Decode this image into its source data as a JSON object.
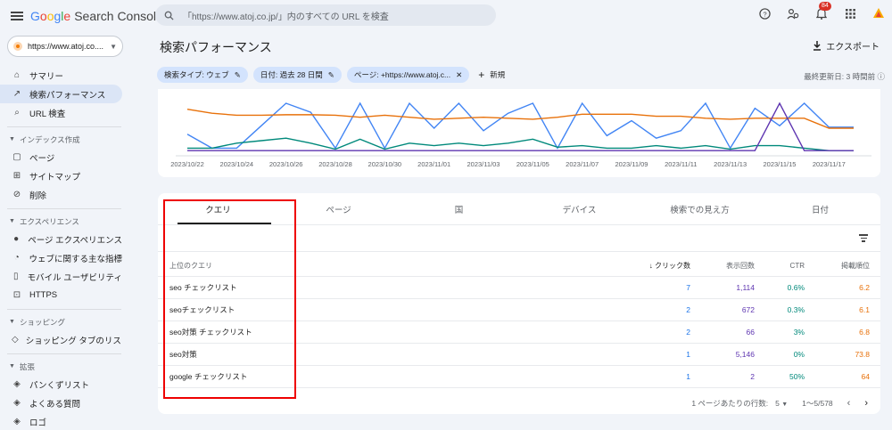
{
  "app": {
    "title_letters": [
      "G",
      "o",
      "o",
      "g",
      "l",
      "e"
    ],
    "title_suffix": "Search Console"
  },
  "search": {
    "placeholder": "「https://www.atoj.co.jp/」内のすべての URL を検査"
  },
  "topbar": {
    "notification_count": "84"
  },
  "sidebar": {
    "property": "https://www.atoj.co....",
    "items": [
      {
        "label": "サマリー",
        "icon": "home-icon"
      },
      {
        "label": "検索パフォーマンス",
        "icon": "trending-up-icon",
        "active": true
      },
      {
        "label": "URL 検査",
        "icon": "search-icon"
      }
    ],
    "sections": [
      {
        "title": "インデックス作成",
        "items": [
          {
            "label": "ページ",
            "icon": "pages-icon"
          },
          {
            "label": "サイトマップ",
            "icon": "sitemap-icon"
          },
          {
            "label": "削除",
            "icon": "removal-icon"
          }
        ]
      },
      {
        "title": "エクスペリエンス",
        "items": [
          {
            "label": "ページ エクスペリエンス",
            "icon": "page-experience-icon"
          },
          {
            "label": "ウェブに関する主な指標",
            "icon": "speed-icon"
          },
          {
            "label": "モバイル ユーザビリティ",
            "icon": "mobile-icon"
          },
          {
            "label": "HTTPS",
            "icon": "lock-icon"
          }
        ]
      },
      {
        "title": "ショッピング",
        "items": [
          {
            "label": "ショッピング タブのリス...",
            "icon": "tag-icon"
          }
        ]
      },
      {
        "title": "拡張",
        "items": [
          {
            "label": "パンくずリスト",
            "icon": "layers-icon"
          },
          {
            "label": "よくある質問",
            "icon": "layers-icon"
          },
          {
            "label": "ロゴ",
            "icon": "layers-icon"
          }
        ]
      }
    ]
  },
  "main": {
    "title": "検索パフォーマンス",
    "export_label": "エクスポート",
    "chips": [
      "検索タイプ: ウェブ",
      "日付: 過去 28 日間",
      "ページ: +https://www.atoj.c..."
    ],
    "new_label": "新規",
    "updated": "最終更新日: 3 時間前"
  },
  "chart_data": {
    "type": "line",
    "x": [
      "2023/10/22",
      "2023/10/23",
      "2023/10/24",
      "2023/10/25",
      "2023/10/26",
      "2023/10/27",
      "2023/10/28",
      "2023/10/29",
      "2023/10/30",
      "2023/10/31",
      "2023/11/01",
      "2023/11/02",
      "2023/11/03",
      "2023/11/04",
      "2023/11/05",
      "2023/11/06",
      "2023/11/07",
      "2023/11/08",
      "2023/11/09",
      "2023/11/10",
      "2023/11/11",
      "2023/11/12",
      "2023/11/13",
      "2023/11/14",
      "2023/11/15",
      "2023/11/16",
      "2023/11/17",
      "2023/11/18"
    ],
    "tick_labels": [
      "2023/10/22",
      "2023/10/24",
      "2023/10/26",
      "2023/10/28",
      "2023/10/30",
      "2023/11/01",
      "2023/11/03",
      "2023/11/05",
      "2023/11/07",
      "2023/11/09",
      "2023/11/11",
      "2023/11/13",
      "2023/11/15",
      "2023/11/17"
    ],
    "series": [
      {
        "color": "#4285f4",
        "values": [
          0.38,
          0.1,
          0.1,
          0.55,
          1.0,
          0.82,
          0.1,
          1.0,
          0.1,
          1.0,
          0.5,
          1.0,
          0.45,
          0.8,
          1.0,
          0.1,
          1.0,
          0.35,
          0.65,
          0.3,
          0.45,
          1.0,
          0.1,
          0.9,
          0.55,
          1.0,
          0.52,
          0.52
        ]
      },
      {
        "color": "#e8710a",
        "values": [
          0.88,
          0.8,
          0.76,
          0.76,
          0.77,
          0.77,
          0.76,
          0.72,
          0.76,
          0.72,
          0.68,
          0.7,
          0.72,
          0.7,
          0.68,
          0.72,
          0.78,
          0.78,
          0.78,
          0.74,
          0.74,
          0.7,
          0.68,
          0.7,
          0.7,
          0.7,
          0.5,
          0.5
        ]
      },
      {
        "color": "#00897b",
        "values": [
          0.1,
          0.1,
          0.2,
          0.25,
          0.3,
          0.2,
          0.08,
          0.28,
          0.08,
          0.2,
          0.15,
          0.2,
          0.15,
          0.2,
          0.28,
          0.12,
          0.15,
          0.1,
          0.1,
          0.15,
          0.1,
          0.15,
          0.08,
          0.15,
          0.15,
          0.1,
          0.05,
          0.05
        ]
      },
      {
        "color": "#5e35b1",
        "values": [
          0.05,
          0.05,
          0.05,
          0.05,
          0.05,
          0.05,
          0.05,
          0.05,
          0.05,
          0.05,
          0.05,
          0.05,
          0.05,
          0.05,
          0.05,
          0.05,
          0.05,
          0.05,
          0.05,
          0.05,
          0.05,
          0.05,
          0.05,
          0.05,
          1.0,
          0.05,
          0.05,
          0.05
        ]
      }
    ]
  },
  "table": {
    "tabs": [
      "クエリ",
      "ページ",
      "国",
      "デバイス",
      "検索での見え方",
      "日付"
    ],
    "headers": {
      "query": "上位のクエリ",
      "clicks": "クリック数",
      "impressions": "表示回数",
      "ctr": "CTR",
      "position": "掲載順位"
    },
    "rows": [
      {
        "query": "seo チェックリスト",
        "clicks": "7",
        "impressions": "1,114",
        "ctr": "0.6%",
        "position": "6.2"
      },
      {
        "query": "seoチェックリスト",
        "clicks": "2",
        "impressions": "672",
        "ctr": "0.3%",
        "position": "6.1"
      },
      {
        "query": "seo対策 チェックリスト",
        "clicks": "2",
        "impressions": "66",
        "ctr": "3%",
        "position": "6.8"
      },
      {
        "query": "seo対策",
        "clicks": "1",
        "impressions": "5,146",
        "ctr": "0%",
        "position": "73.8"
      },
      {
        "query": "google チェックリスト",
        "clicks": "1",
        "impressions": "2",
        "ctr": "50%",
        "position": "64"
      }
    ],
    "pager": {
      "rows_label": "1 ページあたりの行数:",
      "rows_value": "5",
      "range": "1〜5/578"
    }
  }
}
